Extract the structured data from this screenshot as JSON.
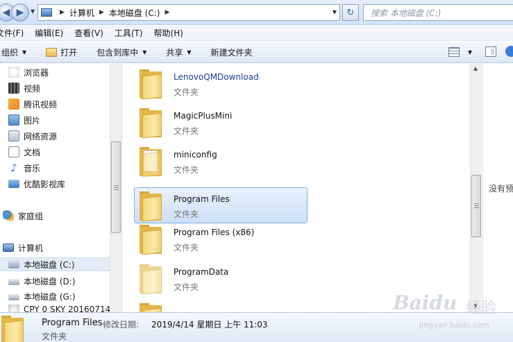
{
  "address": {
    "crumbs": [
      "计算机",
      "本地磁盘 (C:)"
    ],
    "search_placeholder": "搜索 本地磁盘 (C:)"
  },
  "menu": [
    "文件(F)",
    "编辑(E)",
    "查看(V)",
    "工具(T)",
    "帮助(H)"
  ],
  "toolbar": {
    "organize": "组织",
    "open": "打开",
    "include": "包含到库中",
    "share": "共享",
    "new_folder": "新建文件夹"
  },
  "nav": {
    "items": [
      "浏览器",
      "视频",
      "腾讯视频",
      "图片",
      "网络资源",
      "文档",
      "音乐",
      "优酷影视库"
    ],
    "homegroup": "家庭组",
    "computer": "计算机",
    "drives": [
      "本地磁盘 (C:)",
      "本地磁盘 (D:)",
      "本地磁盘 (G:)"
    ],
    "drive_partial": "CPY 0 SKY 20160714"
  },
  "files": [
    {
      "name": "LenovoQMDownload",
      "type": "文件夹"
    },
    {
      "name": "MagicPlusMini",
      "type": "文件夹"
    },
    {
      "name": "miniconfig",
      "type": "文件夹"
    },
    {
      "name": "Program Files",
      "type": "文件夹"
    },
    {
      "name": "Program Files (x86)",
      "type": "文件夹"
    },
    {
      "name": "ProgramData",
      "type": "文件夹"
    }
  ],
  "preview_text": "没有预",
  "details": {
    "name": "Program Files",
    "modified_label": "修改日期:",
    "modified_value": "2019/4/14 星期日 上午 11:03",
    "type": "文件夹"
  },
  "watermark": {
    "brand": "Baidu",
    "cn": "经验",
    "sub": "jingyan.baidu.com"
  },
  "colors": {
    "selection": "#cde0f7",
    "link": "#1a3c9a",
    "folder": "#e3b748"
  }
}
